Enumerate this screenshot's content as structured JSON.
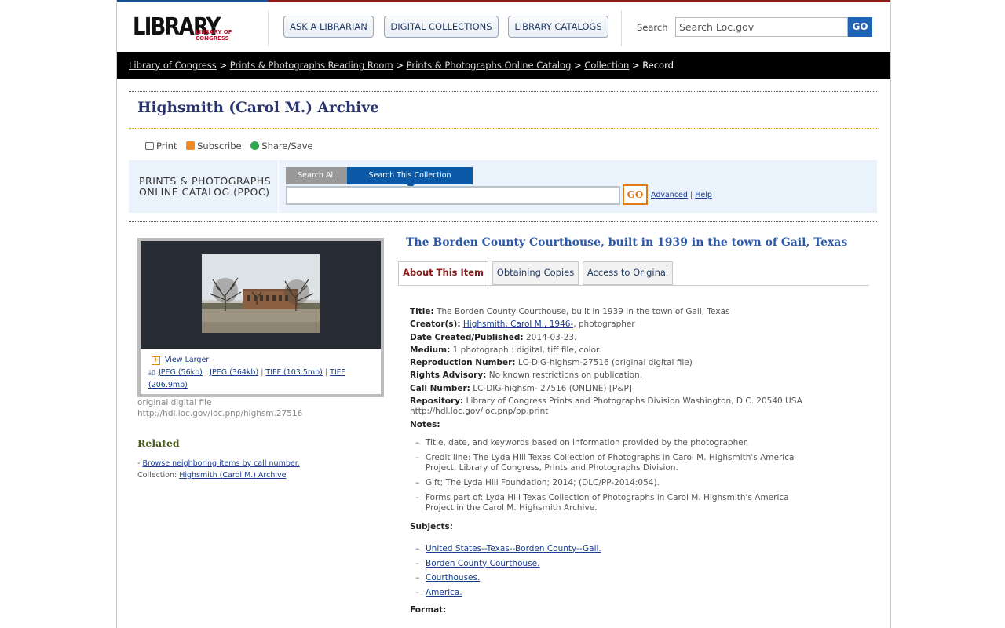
{
  "header": {
    "logo": {
      "main": "LIBRARY",
      "sub": "LIBRARY OF CONGRESS"
    },
    "nav": [
      {
        "label": "ASK A LIBRARIAN"
      },
      {
        "label": "DIGITAL COLLECTIONS"
      },
      {
        "label": "LIBRARY CATALOGS"
      }
    ],
    "search": {
      "label": "Search",
      "placeholder": "Search Loc.gov",
      "button": "GO"
    }
  },
  "breadcrumb": {
    "links": [
      "Library of Congress",
      "Prints & Photographs Reading Room",
      "Prints & Photographs Online Catalog",
      "Collection"
    ],
    "separator": ">",
    "current": "Record"
  },
  "page_title": "Highsmith (Carol M.) Archive",
  "tools": {
    "print": "Print",
    "subscribe": "Subscribe",
    "share": "Share/Save"
  },
  "ppoc": {
    "title_line1": "PRINTS & PHOTOGRAPHS",
    "title_line2": "ONLINE CATALOG (PPOC)",
    "tab_all": "Search All",
    "tab_collection": "Search This Collection",
    "go": "GO",
    "advanced": "Advanced",
    "divider": "|",
    "help": "Help"
  },
  "image_panel": {
    "view_larger": "View Larger",
    "downloads": [
      "JPEG (56kb)",
      "JPEG (364kb)",
      "TIFF (103.5mb)",
      "TIFF (206.9mb)"
    ],
    "download_separator": "|",
    "orig_line1": "original digital file",
    "orig_line2": "http://hdl.loc.gov/loc.pnp/highsm.27516"
  },
  "related": {
    "heading": "Related",
    "browse_prefix": "- ",
    "browse": "Browse neighboring items by call number.",
    "collection_label": "Collection: ",
    "collection_link": "Highsmith (Carol M.) Archive"
  },
  "record": {
    "title": "The Borden County Courthouse, built in 1939 in the town of Gail, Texas",
    "tabs": [
      "About This Item",
      "Obtaining Copies",
      "Access to Original"
    ],
    "fields": {
      "title_label": "Title:",
      "title_value": "The Borden County Courthouse, built in 1939 in the town of Gail, Texas",
      "creator_label": "Creator(s):",
      "creator_link": "Highsmith, Carol M., 1946-",
      "creator_role": ", photographer",
      "date_label": "Date Created/Published:",
      "date_value": "2014-03-23.",
      "medium_label": "Medium:",
      "medium_value": "1 photograph : digital, tiff file, color.",
      "repro_label": "Reproduction Number:",
      "repro_value": "LC-DIG-highsm-27516 (original digital file)",
      "rights_label": "Rights Advisory:",
      "rights_value": "No known restrictions on publication.",
      "call_label": "Call Number:",
      "call_value": "LC-DIG-highsm- 27516 (ONLINE) [P&P]",
      "repo_label": "Repository:",
      "repo_value": "Library of Congress Prints and Photographs Division Washington, D.C. 20540 USA http://hdl.loc.gov/loc.pnp/pp.print",
      "notes_label": "Notes:"
    },
    "notes": [
      "Title, date, and keywords based on information provided by the photographer.",
      "Credit line: The Lyda Hill Texas Collection of Photographs in Carol M. Highsmith's America Project, Library of Congress, Prints and Photographs Division.",
      "Gift; The Lyda Hill Foundation; 2014; (DLC/PP-2014:054).",
      "Forms part of: Lyda Hill Texas Collection of Photographs in Carol M. Highsmith's America Project in the Carol M. Highsmith Archive."
    ],
    "subjects_label": "Subjects:",
    "subjects": [
      "United States--Texas--Borden County--Gail.",
      "Borden County Courthouse.",
      "Courthouses.",
      "America."
    ],
    "format_label": "Format:"
  },
  "colors": {
    "brand_red": "#8b1a1a",
    "link_blue": "#1a3d8f",
    "go_blue": "#1f63b4",
    "ppoc_orange": "#e07a1a"
  }
}
